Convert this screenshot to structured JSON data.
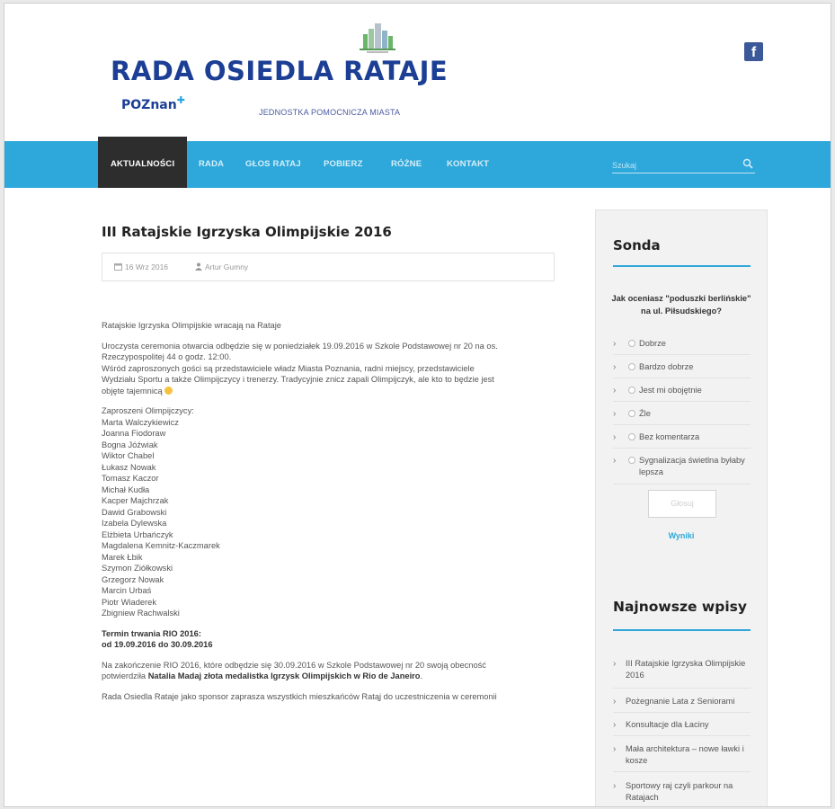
{
  "header": {
    "site_title": "RADA OSIEDLA RATAJE",
    "poznan_logo": "POZnan",
    "subtitle": "JEDNOSTKA POMOCNICZA MIASTA"
  },
  "nav": {
    "items": [
      {
        "label": "AKTUALNOŚCI",
        "active": true
      },
      {
        "label": "RADA"
      },
      {
        "label": "GŁOS RATAJ"
      },
      {
        "label": "POBIERZ"
      },
      {
        "label": "RÓŻNE"
      },
      {
        "label": "KONTAKT"
      }
    ],
    "search_placeholder": "Szukaj"
  },
  "post": {
    "title": "III Ratajskie Igrzyska Olimpijskie 2016",
    "date": "16 Wrz 2016",
    "author": "Artur Gumny",
    "p1": "Ratajskie Igrzyska Olimpijskie wracają na Rataje",
    "p2a": "Uroczysta ceremonia otwarcia odbędzie się w poniedziałek 19.09.2016 w Szkole Podstawowej nr 20 na os.",
    "p2b": "Rzeczypospolitej 44 o godz. 12:00.",
    "p2c": "Wśród zaproszonych gości są przedstawiciele władz Miasta Poznania, radni miejscy, przedstawiciele",
    "p2d": "Wydziału Sportu a także Olimpijczycy i trenerzy. Tradycyjnie znicz zapali Olimpijczyk, ale kto to będzie jest",
    "p2e": "objęte tajemnicą",
    "olympians_heading": "Zaproszeni Olimpijczycy:",
    "olympians": [
      "Marta Walczykiewicz",
      "Joanna Fiodoraw",
      "Bogna Jóźwiak",
      "Wiktor Chabel",
      "Łukasz Nowak",
      "Tomasz Kaczor",
      "Michał Kudła",
      "Kacper Majchrzak",
      "Dawid Grabowski",
      "Izabela Dylewska",
      "Elżbieta Urbańczyk",
      "Magdalena Kemnitz-Kaczmarek",
      "Marek Łbik",
      "Szymon Ziółkowski",
      "Grzegorz Nowak",
      "Marcin Urbaś",
      "Piotr Wiaderek",
      "Zbigniew Rachwalski"
    ],
    "term_line1": "Termin trwania RIO 2016:",
    "term_line2": "od 19.09.2016 do 30.09.2016",
    "p4a": "Na zakończenie RIO 2016, które odbędzie się 30.09.2016 w Szkole Podstawowej nr 20 swoją obecność",
    "p4b": "potwierdziła ",
    "p4c": "Natalia Madaj złota medalistka Igrzysk Olimpijskich w Rio de Janeiro",
    "p4d": ".",
    "p5": "Rada Osiedla Rataje jako sponsor zaprasza wszystkich mieszkańców Ratąj do uczestniczenia w ceremonii"
  },
  "sidebar": {
    "poll_title": "Sonda",
    "poll_question": "Jak oceniasz \"poduszki berlińskie\" na ul. Piłsudskiego?",
    "poll_options": [
      "Dobrze",
      "Bardzo dobrze",
      "Jest mi obojętnie",
      "Źle",
      "Bez komentarza",
      "Sygnalizacja świetlna byłaby lepsza"
    ],
    "vote_label": "Głosuj",
    "results_label": "Wyniki",
    "recent_title": "Najnowsze wpisy",
    "recent_posts": [
      "III Ratajskie Igrzyska Olimpijskie 2016",
      "Pożegnanie Lata z Seniorami",
      "Konsultacje dla Łaciny",
      "Mała architektura – nowe ławki i kosze",
      "Sportowy raj czyli parkour na Ratajach"
    ]
  },
  "colors": {
    "brand_blue": "#1c3f95",
    "nav_blue": "#2ea8db",
    "nav_active": "#2d2d2d",
    "facebook": "#3b5998"
  }
}
